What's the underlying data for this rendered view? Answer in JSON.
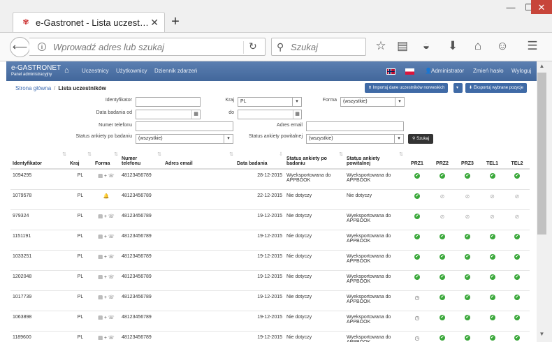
{
  "browser": {
    "tab_title": "e-Gastronet - Lista uczest…",
    "url_placeholder": "Wprowadź adres lub szukaj",
    "search_placeholder": "Szukaj"
  },
  "brand": {
    "title": "e-GASTRONET",
    "subtitle": "Panel administracyjny"
  },
  "nav": {
    "items": [
      "Uczestnicy",
      "Użytkownicy",
      "Dziennik zdarzeń"
    ],
    "admin": "Administrator",
    "change_password": "Zmień hasło",
    "logout": "Wyloguj"
  },
  "breadcrumb": {
    "home": "Strona główna",
    "current": "Lista uczestników"
  },
  "actions": {
    "import": "Importuj dane uczestników norweskich",
    "export": "Eksportuj wybrane pozycje"
  },
  "filters": {
    "identyfikator": "Identyfikator",
    "kraj": "Kraj",
    "kraj_value": "PL",
    "forma": "Forma",
    "forma_value": "(wszystkie)",
    "data_od": "Data badania od",
    "do": "do",
    "telefon": "Numer telefonu",
    "email": "Adres email",
    "status_po_badaniu": "Status ankiety po badaniu",
    "status_po_badaniu_value": "(wszystkie)",
    "status_powitalnej": "Status ankiety powitalnej",
    "status_powitalnej_value": "(wszystkie)",
    "search_button": "Szukaj"
  },
  "columns": [
    "Identyfikator",
    "Kraj",
    "Forma",
    "Numer telefonu",
    "Adres email",
    "Data badania",
    "Status ankiety po badaniu",
    "Status ankiety powitalnej",
    "PRZ1",
    "PRZ2",
    "PRZ3",
    "TEL1",
    "TEL2"
  ],
  "rows": [
    {
      "id": "1094295",
      "kraj": "PL",
      "forma": "📞+✉",
      "tel": "48123456789",
      "email": "",
      "data": "28-12-2015",
      "status1": "Wyeksportowana do APPBOOK",
      "status2": "Wyeksportowana do APPBOOK",
      "marks": [
        "ok",
        "ok",
        "ok",
        "ok",
        "ok"
      ]
    },
    {
      "id": "1079578",
      "kraj": "PL",
      "forma": "bell",
      "tel": "48123456789",
      "email": "",
      "data": "22-12-2015",
      "status1": "Nie dotyczy",
      "status2": "Nie dotyczy",
      "marks": [
        "ok",
        "no",
        "no",
        "no",
        "no"
      ]
    },
    {
      "id": "979324",
      "kraj": "PL",
      "forma": "📞+✉",
      "tel": "48123456789",
      "email": "",
      "data": "19-12-2015",
      "status1": "Nie dotyczy",
      "status2": "Wyeksportowana do APPBOOK",
      "marks": [
        "ok",
        "no",
        "no",
        "no",
        "no"
      ]
    },
    {
      "id": "1151191",
      "kraj": "PL",
      "forma": "📞+✉",
      "tel": "48123456789",
      "email": "",
      "data": "19-12-2015",
      "status1": "Nie dotyczy",
      "status2": "Wyeksportowana do APPBOOK",
      "marks": [
        "ok",
        "ok",
        "ok",
        "ok",
        "ok"
      ]
    },
    {
      "id": "1033251",
      "kraj": "PL",
      "forma": "📞+✉",
      "tel": "48123456789",
      "email": "",
      "data": "19-12-2015",
      "status1": "Nie dotyczy",
      "status2": "Wyeksportowana do APPBOOK",
      "marks": [
        "ok",
        "ok",
        "ok",
        "ok",
        "ok"
      ]
    },
    {
      "id": "1202048",
      "kraj": "PL",
      "forma": "📞+✉",
      "tel": "48123456789",
      "email": "",
      "data": "19-12-2015",
      "status1": "Nie dotyczy",
      "status2": "Wyeksportowana do APPBOOK",
      "marks": [
        "ok",
        "ok",
        "ok",
        "ok",
        "ok"
      ]
    },
    {
      "id": "1017739",
      "kraj": "PL",
      "forma": "📞+✉",
      "tel": "48123456789",
      "email": "",
      "data": "19-12-2015",
      "status1": "Nie dotyczy",
      "status2": "Wyeksportowana do APPBOOK",
      "marks": [
        "clock",
        "ok",
        "ok",
        "ok",
        "ok"
      ]
    },
    {
      "id": "1063898",
      "kraj": "PL",
      "forma": "📞+✉",
      "tel": "48123456789",
      "email": "",
      "data": "19-12-2015",
      "status1": "Nie dotyczy",
      "status2": "Wyeksportowana do APPBOOK",
      "marks": [
        "clock",
        "ok",
        "ok",
        "ok",
        "ok"
      ]
    },
    {
      "id": "1189600",
      "kraj": "PL",
      "forma": "📞+✉",
      "tel": "48123456789",
      "email": "",
      "data": "19-12-2015",
      "status1": "Nie dotyczy",
      "status2": "Wyeksportowana do APPBOOK",
      "marks": [
        "clock",
        "ok",
        "ok",
        "ok",
        "ok"
      ]
    }
  ]
}
